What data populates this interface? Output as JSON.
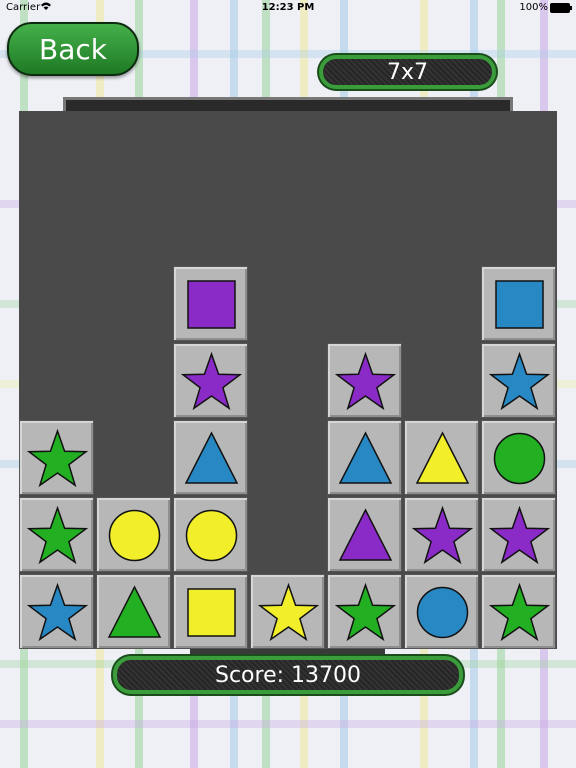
{
  "status": {
    "carrier": "Carrier",
    "time": "12:23 PM",
    "battery": "100%"
  },
  "back_button": {
    "label": "Back"
  },
  "level": {
    "label": "7x7"
  },
  "score": {
    "label": "Score: 13700"
  },
  "colors": {
    "green": "#22b022",
    "yellow": "#f2ef2a",
    "blue": "#2888c4",
    "purple": "#8a2bc8",
    "tile": "#b7b7b7",
    "board": "#4a4a4a",
    "accent": "#3a9c3a"
  },
  "grid": {
    "rows": 7,
    "cols": 7
  },
  "tiles": [
    {
      "row": 3,
      "col": 2,
      "shape": "square",
      "color": "purple"
    },
    {
      "row": 3,
      "col": 6,
      "shape": "square",
      "color": "blue"
    },
    {
      "row": 4,
      "col": 2,
      "shape": "star",
      "color": "purple"
    },
    {
      "row": 4,
      "col": 4,
      "shape": "star",
      "color": "purple"
    },
    {
      "row": 4,
      "col": 6,
      "shape": "star",
      "color": "blue"
    },
    {
      "row": 5,
      "col": 0,
      "shape": "star",
      "color": "green"
    },
    {
      "row": 5,
      "col": 2,
      "shape": "triangle",
      "color": "blue"
    },
    {
      "row": 5,
      "col": 4,
      "shape": "triangle",
      "color": "blue"
    },
    {
      "row": 5,
      "col": 5,
      "shape": "triangle",
      "color": "yellow"
    },
    {
      "row": 5,
      "col": 6,
      "shape": "circle",
      "color": "green"
    },
    {
      "row": 6,
      "col": 0,
      "shape": "star",
      "color": "green"
    },
    {
      "row": 6,
      "col": 1,
      "shape": "circle",
      "color": "yellow"
    },
    {
      "row": 6,
      "col": 2,
      "shape": "circle",
      "color": "yellow"
    },
    {
      "row": 6,
      "col": 4,
      "shape": "triangle",
      "color": "purple"
    },
    {
      "row": 6,
      "col": 5,
      "shape": "star",
      "color": "purple"
    },
    {
      "row": 6,
      "col": 6,
      "shape": "star",
      "color": "purple"
    },
    {
      "row": 7,
      "col": 0,
      "shape": "star",
      "color": "blue"
    },
    {
      "row": 7,
      "col": 1,
      "shape": "triangle",
      "color": "green"
    },
    {
      "row": 7,
      "col": 2,
      "shape": "square",
      "color": "yellow"
    },
    {
      "row": 7,
      "col": 3,
      "shape": "star",
      "color": "yellow"
    },
    {
      "row": 7,
      "col": 4,
      "shape": "star",
      "color": "green"
    },
    {
      "row": 7,
      "col": 5,
      "shape": "circle",
      "color": "blue"
    },
    {
      "row": 7,
      "col": 6,
      "shape": "star",
      "color": "green"
    }
  ]
}
